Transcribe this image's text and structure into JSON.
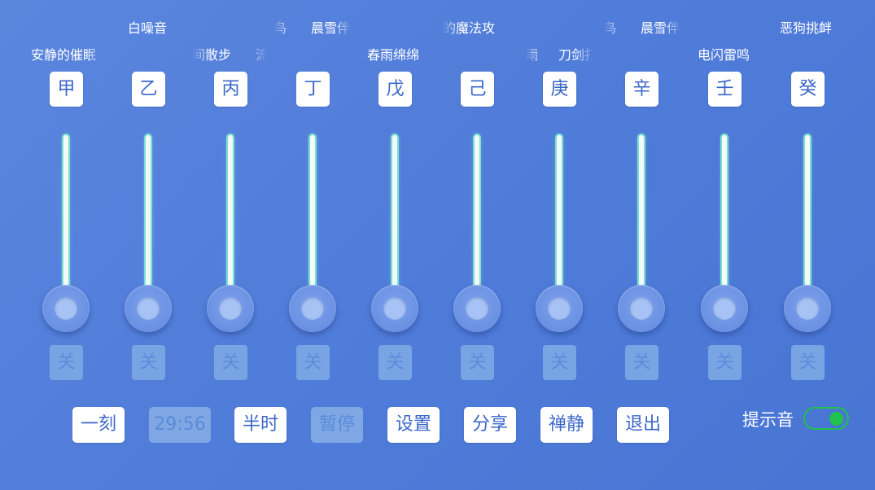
{
  "marquee": {
    "row1": [
      {
        "text": "白噪音"
      },
      {
        "text": "鸟"
      },
      {
        "text": "晨雪伴"
      },
      {
        "text": "的魔法攻"
      },
      {
        "text": "鸟"
      },
      {
        "text": "晨雪伴"
      },
      {
        "text": "恶狗挑衅"
      }
    ],
    "row2": [
      {
        "text": "安静的催眠"
      },
      {
        "text": "间散步"
      },
      {
        "text": "流"
      },
      {
        "text": "春雨绵绵"
      },
      {
        "text": "雨"
      },
      {
        "text": "刀剑打"
      },
      {
        "text": "电闪雷鸣"
      }
    ]
  },
  "channels": [
    {
      "label": "甲",
      "toggle": "关",
      "level": 0
    },
    {
      "label": "乙",
      "toggle": "关",
      "level": 0
    },
    {
      "label": "丙",
      "toggle": "关",
      "level": 0
    },
    {
      "label": "丁",
      "toggle": "关",
      "level": 0
    },
    {
      "label": "戊",
      "toggle": "关",
      "level": 0
    },
    {
      "label": "己",
      "toggle": "关",
      "level": 0
    },
    {
      "label": "庚",
      "toggle": "关",
      "level": 0
    },
    {
      "label": "辛",
      "toggle": "关",
      "level": 0
    },
    {
      "label": "壬",
      "toggle": "关",
      "level": 0
    },
    {
      "label": "癸",
      "toggle": "关",
      "level": 0
    }
  ],
  "controls": {
    "buttons": [
      {
        "label": "一刻",
        "enabled": true
      },
      {
        "label": "29:56",
        "enabled": false
      },
      {
        "label": "半时",
        "enabled": true
      },
      {
        "label": "暂停",
        "enabled": false
      },
      {
        "label": "设置",
        "enabled": true
      },
      {
        "label": "分享",
        "enabled": true
      },
      {
        "label": "禅静",
        "enabled": true
      },
      {
        "label": "退出",
        "enabled": true
      }
    ],
    "cue_sound": {
      "label": "提示音",
      "on": true
    }
  },
  "colors": {
    "background": "#5080db",
    "chip_text": "#3b67c9",
    "track_glow": "#78e2cf",
    "switch_on": "#1fc24a"
  }
}
